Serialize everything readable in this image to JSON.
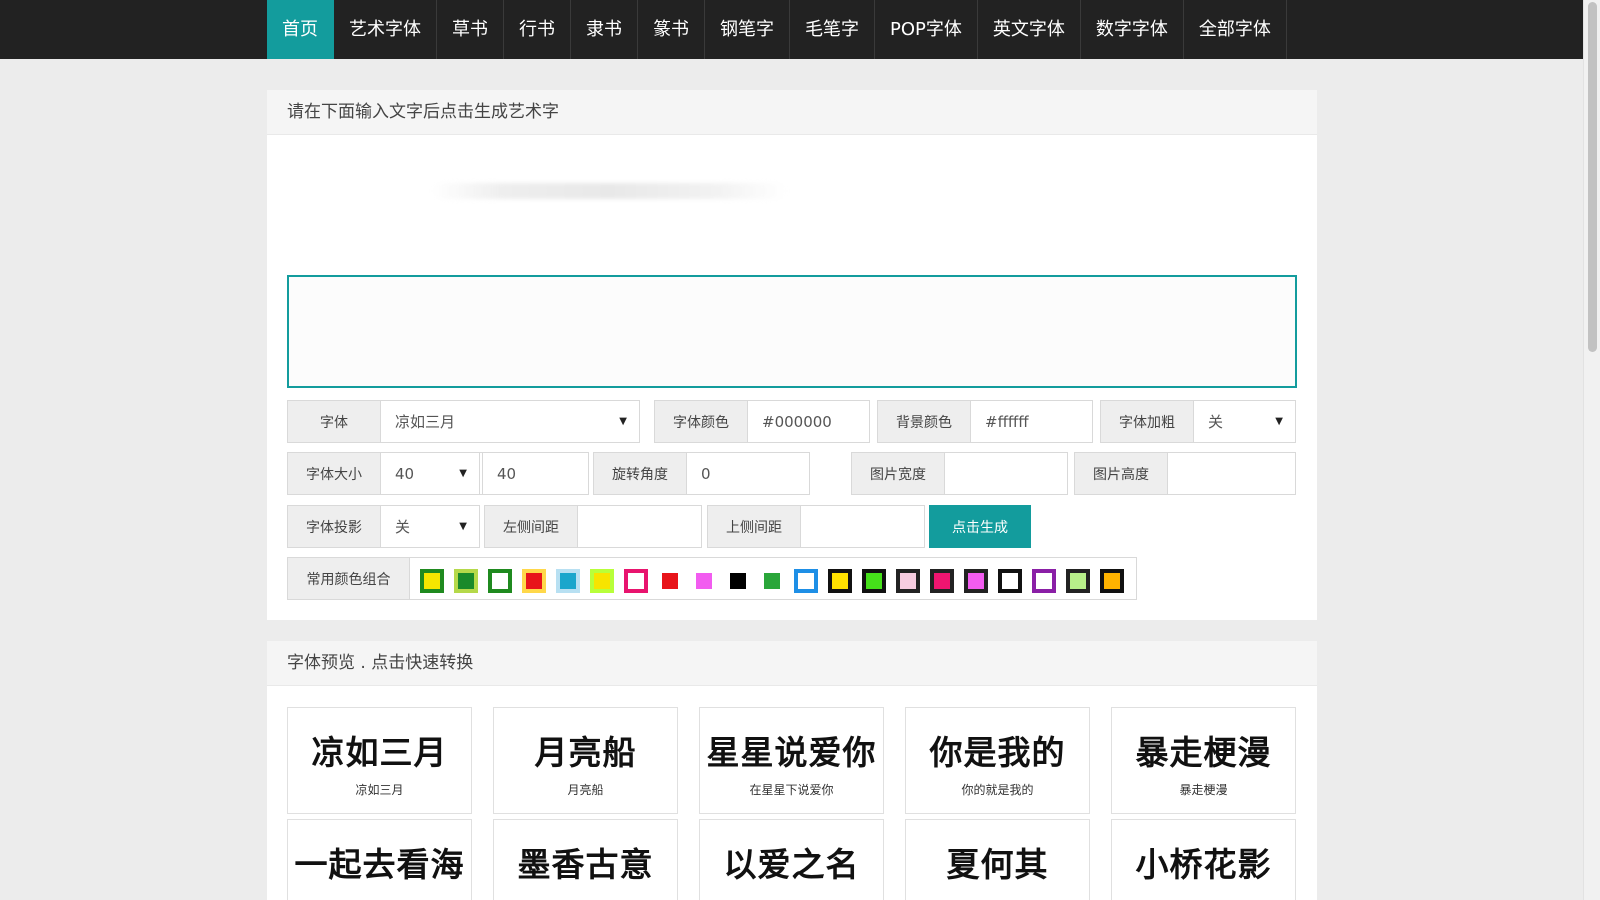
{
  "nav": {
    "items": [
      {
        "label": "首页",
        "active": true
      },
      {
        "label": "艺术字体"
      },
      {
        "label": "草书"
      },
      {
        "label": "行书"
      },
      {
        "label": "隶书"
      },
      {
        "label": "篆书"
      },
      {
        "label": "钢笔字"
      },
      {
        "label": "毛笔字"
      },
      {
        "label": "POP字体"
      },
      {
        "label": "英文字体"
      },
      {
        "label": "数字字体"
      },
      {
        "label": "全部字体"
      }
    ]
  },
  "generator": {
    "title": "请在下面输入文字后点击生成艺术字",
    "font_label": "字体",
    "font_value": "凉如三月",
    "font_color_label": "字体颜色",
    "font_color_value": "#000000",
    "bg_color_label": "背景颜色",
    "bg_color_value": "#ffffff",
    "bold_label": "字体加粗",
    "bold_value": "关",
    "size_label": "字体大小",
    "size_select_value": "40",
    "size_input_value": "40",
    "rotate_label": "旋转角度",
    "rotate_value": "0",
    "width_label": "图片宽度",
    "height_label": "图片高度",
    "shadow_label": "字体投影",
    "shadow_value": "关",
    "left_margin_label": "左侧间距",
    "top_margin_label": "上侧间距",
    "generate_label": "点击生成",
    "combo_label": "常用颜色组合",
    "swatches": [
      {
        "outer": "#1f8a1f",
        "inner": "#f5e600"
      },
      {
        "outer": "#b5d94a",
        "inner": "#1a8a2a"
      },
      {
        "outer": "#1f8a1f",
        "inner": "#ffffff"
      },
      {
        "outer": "#ffd84a",
        "inner": "#e8141a"
      },
      {
        "outer": "#b8e0f2",
        "inner": "#1aa6cc"
      },
      {
        "outer": "#b8ff3a",
        "inner": "#f7e400"
      },
      {
        "outer": "#e8146e",
        "inner": "#ffffff"
      },
      {
        "outer": "#ffffff",
        "inner": "#e8141a"
      },
      {
        "outer": "#ffffff",
        "inner": "#f25cf0"
      },
      {
        "outer": "#ffffff",
        "inner": "#000000"
      },
      {
        "outer": "#ffffff",
        "inner": "#2aa63a"
      },
      {
        "outer": "#1e8fe6",
        "inner": "#ffffff"
      },
      {
        "outer": "#111111",
        "inner": "#ffe100"
      },
      {
        "outer": "#111111",
        "inner": "#45e01a"
      },
      {
        "outer": "#222222",
        "inner": "#f7cce0"
      },
      {
        "outer": "#222222",
        "inner": "#f01570"
      },
      {
        "outer": "#222222",
        "inner": "#f25cf0"
      },
      {
        "outer": "#111111",
        "inner": "#ffffff"
      },
      {
        "outer": "#8a1fa6",
        "inner": "#ffffff"
      },
      {
        "outer": "#222222",
        "inner": "#b8f08a"
      },
      {
        "outer": "#111111",
        "inner": "#ffb300"
      }
    ]
  },
  "preview": {
    "title": "字体预览 . 点击快速转换",
    "cards": [
      {
        "art": "凉如三月",
        "name": "凉如三月"
      },
      {
        "art": "月亮船",
        "name": "月亮船"
      },
      {
        "art": "星星说爱你",
        "name": "在星星下说爱你"
      },
      {
        "art": "你是我的",
        "name": "你的就是我的"
      },
      {
        "art": "暴走梗漫",
        "name": "暴走梗漫"
      },
      {
        "art": "一起去看海",
        "name": ""
      },
      {
        "art": "墨香古意",
        "name": ""
      },
      {
        "art": "以爱之名",
        "name": ""
      },
      {
        "art": "夏何其",
        "name": ""
      },
      {
        "art": "小桥花影",
        "name": ""
      }
    ]
  }
}
